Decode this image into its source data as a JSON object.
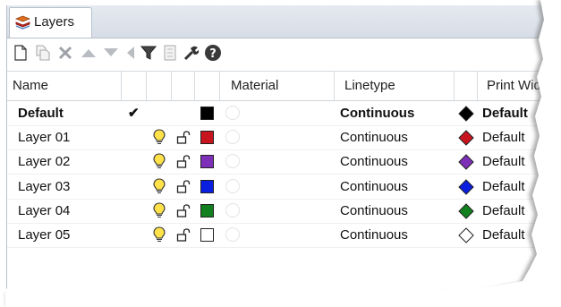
{
  "tab": {
    "label": "Layers"
  },
  "toolbar": {
    "icons": [
      "new-layer-icon",
      "new-sublayer-icon",
      "delete-icon",
      "move-up-icon",
      "move-down-icon",
      "move-to-parent-icon",
      "filter-icon",
      "tools-icon",
      "settings-icon",
      "help-icon"
    ]
  },
  "columns": {
    "name": "Name",
    "current": "",
    "visible": "",
    "locked": "",
    "color": "",
    "material": "Material",
    "linetype": "Linetype",
    "print_color": "",
    "print_width": "Print Width"
  },
  "current_mark": "✔",
  "rows": [
    {
      "name": "Default",
      "current": true,
      "visible": false,
      "locked": false,
      "color": "#000000",
      "linetype": "Continuous",
      "print_color": "#000000",
      "print_width": "Default",
      "bold": true
    },
    {
      "name": "Layer 01",
      "current": false,
      "visible": true,
      "locked": false,
      "color": "#c8141e",
      "linetype": "Continuous",
      "print_color": "#c8141e",
      "print_width": "Default",
      "bold": false
    },
    {
      "name": "Layer 02",
      "current": false,
      "visible": true,
      "locked": false,
      "color": "#7e2fb8",
      "linetype": "Continuous",
      "print_color": "#7e2fb8",
      "print_width": "Default",
      "bold": false
    },
    {
      "name": "Layer 03",
      "current": false,
      "visible": true,
      "locked": false,
      "color": "#0a1ee0",
      "linetype": "Continuous",
      "print_color": "#0a1ee0",
      "print_width": "Default",
      "bold": false
    },
    {
      "name": "Layer 04",
      "current": false,
      "visible": true,
      "locked": false,
      "color": "#12801e",
      "linetype": "Continuous",
      "print_color": "#12801e",
      "print_width": "Default",
      "bold": false
    },
    {
      "name": "Layer 05",
      "current": false,
      "visible": true,
      "locked": false,
      "color": "#ffffff",
      "linetype": "Continuous",
      "print_color": "#ffffff",
      "print_width": "Default",
      "bold": false
    }
  ]
}
